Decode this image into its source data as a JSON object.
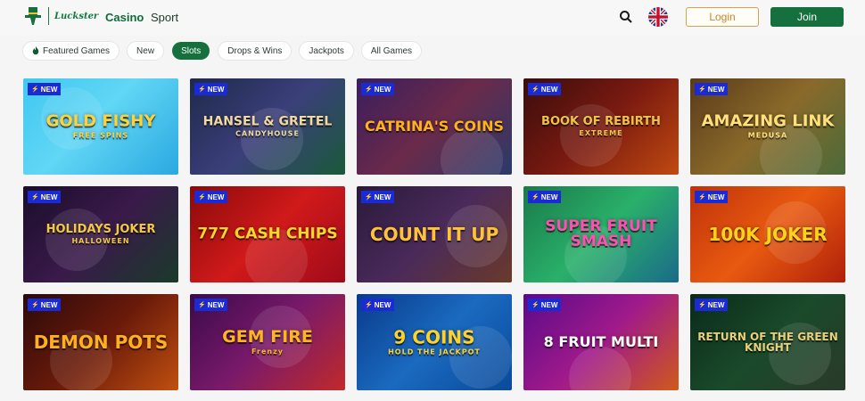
{
  "header": {
    "brand": "Luckster",
    "nav": {
      "casino": "Casino",
      "sport": "Sport"
    },
    "login_label": "Login",
    "join_label": "Join",
    "search_icon": "search-icon",
    "language_icon": "uk-flag-icon"
  },
  "filters": [
    {
      "label": "Featured Games",
      "icon": "flame-icon",
      "active": false
    },
    {
      "label": "New",
      "active": false
    },
    {
      "label": "Slots",
      "active": true
    },
    {
      "label": "Drops & Wins",
      "active": false
    },
    {
      "label": "Jackpots",
      "active": false
    },
    {
      "label": "All Games",
      "active": false
    }
  ],
  "badge_label": "NEW",
  "games": [
    {
      "title": "GOLD FISHY",
      "sub": "FREE SPINS",
      "bg": "linear-gradient(135deg,#3fc8f0 0%,#61d6f5 45%,#2aa8e0 100%)",
      "color": "#ffd23a"
    },
    {
      "title": "HANSEL & GRETEL",
      "sub": "CANDYHOUSE",
      "bg": "linear-gradient(135deg,#1e2a4a 0%,#3b3f7a 50%,#1a5a3a 100%)",
      "color": "#f2d9a2"
    },
    {
      "title": "CATRINA'S COINS",
      "sub": "",
      "bg": "linear-gradient(135deg,#3a1e5e 0%,#6b2a4a 50%,#2a3a6a 100%)",
      "color": "#ffb21a"
    },
    {
      "title": "BOOK OF REBIRTH",
      "sub": "EXTREME",
      "bg": "linear-gradient(135deg,#3a0d0d 0%,#7a1a10 50%,#c04a10 100%)",
      "color": "#f0c24a"
    },
    {
      "title": "AMAZING LINK",
      "sub": "MEDUSA",
      "bg": "linear-gradient(135deg,#5a3a1a 0%,#8a6a2a 50%,#4a6a3a 100%)",
      "color": "#ffe07a"
    },
    {
      "title": "HOLIDAYS JOKER",
      "sub": "HALLOWEEN",
      "bg": "linear-gradient(135deg,#1a0d2a 0%,#3a1a4a 50%,#1a3a2a 100%)",
      "color": "#f5c842"
    },
    {
      "title": "777 CASH CHIPS",
      "sub": "",
      "bg": "linear-gradient(135deg,#8a0a0a 0%,#d01a1a 50%,#a00a1a 100%)",
      "color": "#ffd52a"
    },
    {
      "title": "COUNT IT UP",
      "sub": "",
      "bg": "linear-gradient(135deg,#2a1a3a 0%,#4a2a5a 50%,#6a3a2a 100%)",
      "color": "#ffc23a"
    },
    {
      "title": "SUPER FRUIT SMASH",
      "sub": "",
      "bg": "linear-gradient(135deg,#1a7a4a 0%,#2ab06a 50%,#1a6a8a 100%)",
      "color": "#ff4fb0"
    },
    {
      "title": "100K JOKER",
      "sub": "",
      "bg": "linear-gradient(135deg,#c0320a 0%,#e85a10 50%,#b0200a 100%)",
      "color": "#ffd21a"
    },
    {
      "title": "DEMON POTS",
      "sub": "",
      "bg": "linear-gradient(135deg,#2a0a0a 0%,#6a1a0a 50%,#c05010 100%)",
      "color": "#ffb020"
    },
    {
      "title": "GEM FIRE",
      "sub": "Frenzy",
      "bg": "linear-gradient(135deg,#3a0a4a 0%,#7a1a6a 50%,#c02a2a 100%)",
      "color": "#ffb520"
    },
    {
      "title": "9 COINS",
      "sub": "HOLD THE JACKPOT",
      "bg": "linear-gradient(135deg,#0a3a8a 0%,#1a6ac0 50%,#0a4a9a 100%)",
      "color": "#ffd22a"
    },
    {
      "title": "8 FRUIT MULTI",
      "sub": "",
      "bg": "linear-gradient(135deg,#5a0a8a 0%,#a01a8a 50%,#d05a1a 100%)",
      "color": "#ffffff"
    },
    {
      "title": "RETURN OF THE GREEN KNIGHT",
      "sub": "",
      "bg": "linear-gradient(135deg,#0a2a1a 0%,#1a4a2a 50%,#2a3a2a 100%)",
      "color": "#e8d07a"
    }
  ]
}
